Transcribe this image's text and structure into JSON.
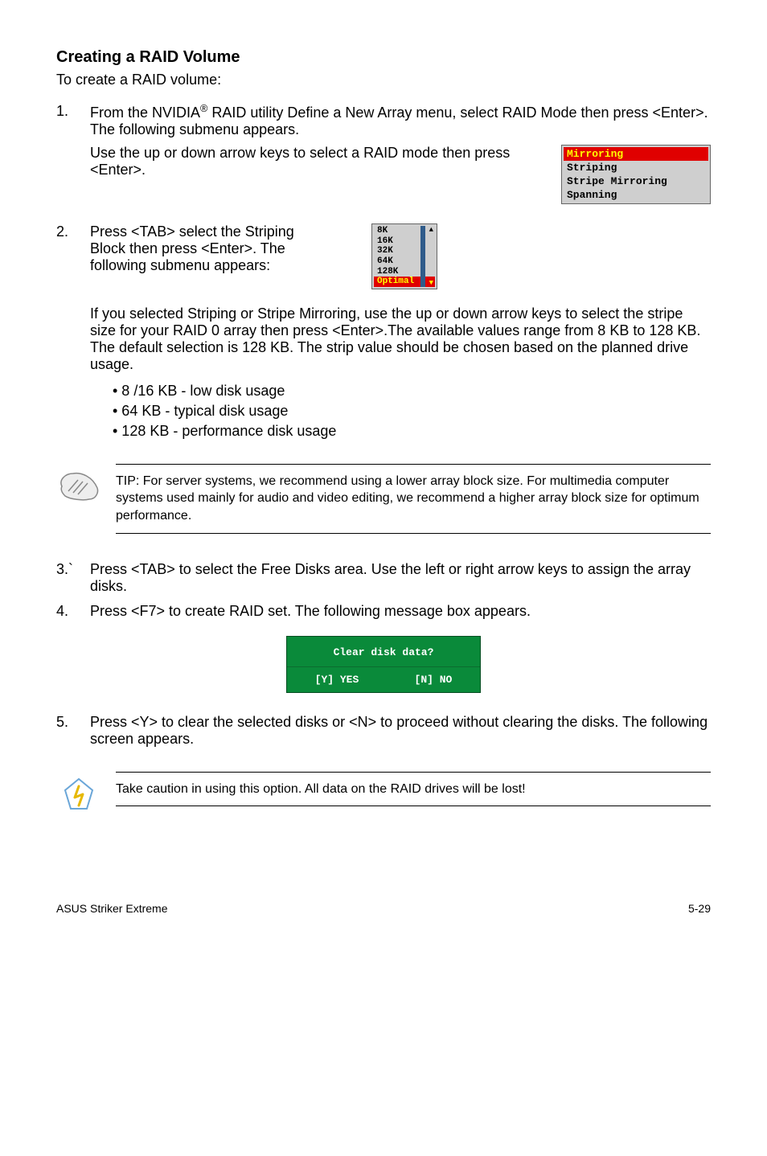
{
  "heading": "Creating a RAID Volume",
  "intro": "To create a RAID volume:",
  "steps": {
    "s1": {
      "num": "1.",
      "text_a": "From the NVIDIA",
      "reg": "®",
      "text_b": " RAID utility Define a New Array menu, select RAID Mode then press <Enter>. The following submenu appears.",
      "text_c": "Use the up or down arrow keys to select a RAID mode then press <Enter>."
    },
    "s2": {
      "num": "2.",
      "text": "Press <TAB> select the Striping Block then press <Enter>. The following submenu appears:"
    },
    "s2_para": "If you selected Striping or Stripe Mirroring, use the up or down arrow keys to select the stripe size for your RAID 0 array then press <Enter>.The available values range from 8 KB to 128 KB. The default selection is 128 KB. The strip value should be chosen based on the planned drive usage.",
    "bullets": {
      "b1": "• 8 /16 KB - low disk usage",
      "b2": "• 64 KB - typical disk usage",
      "b3": "• 128 KB - performance disk usage"
    },
    "tip": "TIP: For server systems, we recommend using a lower array block size. For multimedia computer systems used mainly for audio and video editing, we recommend a higher array block size for optimum performance.",
    "s3": {
      "num": "3.`",
      "text": "Press <TAB> to select the Free Disks area. Use the left or right arrow keys to assign the array disks."
    },
    "s4": {
      "num": "4.",
      "text": "Press <F7> to create RAID set. The following message box appears."
    },
    "s5": {
      "num": "5.",
      "text": "Press <Y> to clear the selected disks or <N> to proceed without clearing the disks. The following screen appears."
    },
    "caution": "Take caution in using this option. All data on the RAID drives will be lost!"
  },
  "raid_menu": {
    "m1": "Mirroring",
    "m2": "Striping",
    "m3": "Stripe Mirroring",
    "m4": "Spanning"
  },
  "stripe_menu": {
    "o1": "8K",
    "o2": "16K",
    "o3": "32K",
    "o4": "64K",
    "o5": "128K",
    "o6": "Optimal"
  },
  "dialog": {
    "title": "Clear disk data?",
    "yes": "[Y] YES",
    "no": "[N] NO"
  },
  "footer": {
    "left": "ASUS Striker Extreme",
    "right": "5-29"
  }
}
